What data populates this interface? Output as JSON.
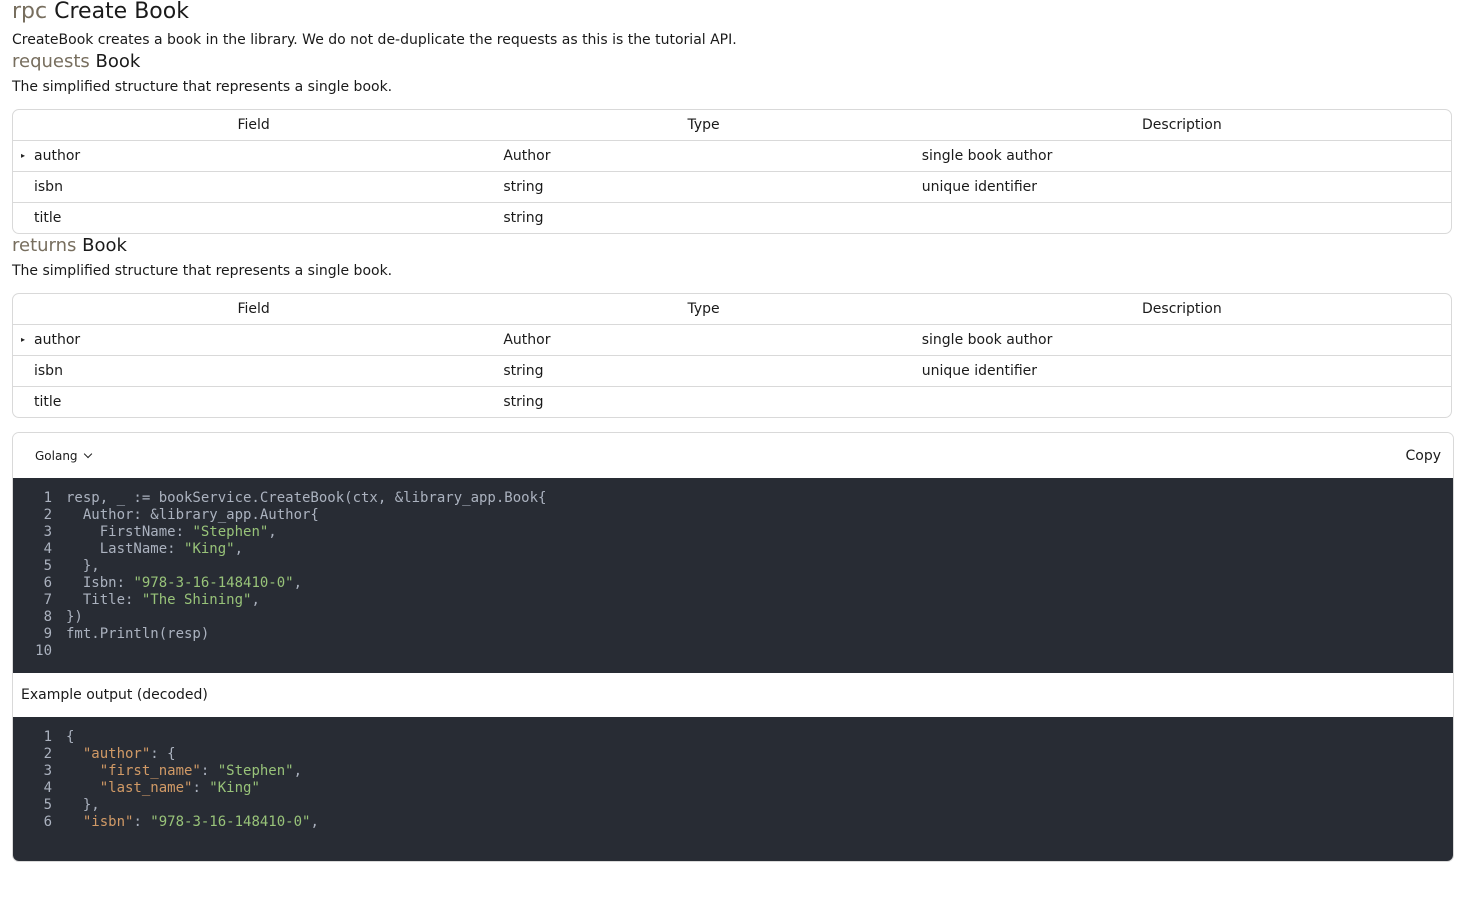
{
  "rpc": {
    "keyword": "rpc",
    "name": "Create Book",
    "description": "CreateBook creates a book in the library. We do not de-duplicate the requests as this is the tutorial API."
  },
  "requests": {
    "keyword": "requests",
    "type_name": "Book",
    "description": "The simplified structure that represents a single book.",
    "headers": [
      "Field",
      "Type",
      "Description"
    ],
    "rows": [
      {
        "field": "author",
        "type": "Author",
        "description": "single book author",
        "expandable": true
      },
      {
        "field": "isbn",
        "type": "string",
        "description": "unique identifier",
        "expandable": false
      },
      {
        "field": "title",
        "type": "string",
        "description": "",
        "expandable": false
      }
    ]
  },
  "returns": {
    "keyword": "returns",
    "type_name": "Book",
    "description": "The simplified structure that represents a single book.",
    "headers": [
      "Field",
      "Type",
      "Description"
    ],
    "rows": [
      {
        "field": "author",
        "type": "Author",
        "description": "single book author",
        "expandable": true
      },
      {
        "field": "isbn",
        "type": "string",
        "description": "unique identifier",
        "expandable": false
      },
      {
        "field": "title",
        "type": "string",
        "description": "",
        "expandable": false
      }
    ]
  },
  "code": {
    "language": "Golang",
    "copy_label": "Copy",
    "lines": [
      [
        {
          "t": "resp, _ := bookService.CreateBook(ctx, &library_app.Book{"
        }
      ],
      [
        {
          "t": "  Author: &library_app.Author{"
        }
      ],
      [
        {
          "t": "    FirstName: "
        },
        {
          "t": "\"Stephen\"",
          "c": "str"
        },
        {
          "t": ","
        }
      ],
      [
        {
          "t": "    LastName: "
        },
        {
          "t": "\"King\"",
          "c": "str"
        },
        {
          "t": ","
        }
      ],
      [
        {
          "t": "  },"
        }
      ],
      [
        {
          "t": "  Isbn: "
        },
        {
          "t": "\"978-3-16-148410-0\"",
          "c": "str"
        },
        {
          "t": ","
        }
      ],
      [
        {
          "t": "  Title: "
        },
        {
          "t": "\"The Shining\"",
          "c": "str"
        },
        {
          "t": ","
        }
      ],
      [
        {
          "t": "})"
        }
      ],
      [
        {
          "t": "fmt.Println(resp)"
        }
      ],
      [
        {
          "t": ""
        }
      ]
    ],
    "output_label": "Example output (decoded)",
    "output_lines": [
      [
        {
          "t": "{"
        }
      ],
      [
        {
          "t": "  "
        },
        {
          "t": "\"author\"",
          "c": "key"
        },
        {
          "t": ": {"
        }
      ],
      [
        {
          "t": "    "
        },
        {
          "t": "\"first_name\"",
          "c": "key"
        },
        {
          "t": ": "
        },
        {
          "t": "\"Stephen\"",
          "c": "str"
        },
        {
          "t": ","
        }
      ],
      [
        {
          "t": "    "
        },
        {
          "t": "\"last_name\"",
          "c": "key"
        },
        {
          "t": ": "
        },
        {
          "t": "\"King\"",
          "c": "str"
        }
      ],
      [
        {
          "t": "  },"
        }
      ],
      [
        {
          "t": "  "
        },
        {
          "t": "\"isbn\"",
          "c": "key"
        },
        {
          "t": ": "
        },
        {
          "t": "\"978-3-16-148410-0\"",
          "c": "str"
        },
        {
          "t": ","
        }
      ]
    ]
  },
  "colors": {
    "keyword": "#776e5e",
    "code_bg": "#282c34",
    "code_text": "#abb2bf",
    "string": "#98c379",
    "json_key": "#d19a66"
  }
}
